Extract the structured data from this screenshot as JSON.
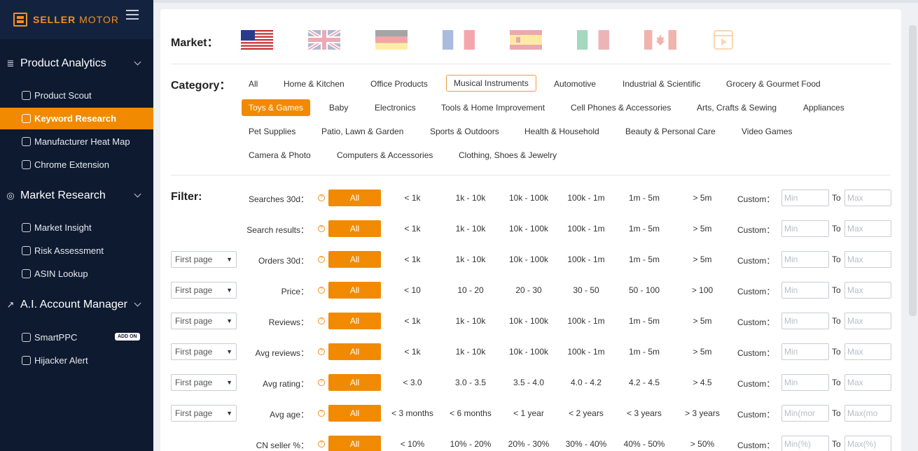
{
  "brand": {
    "bold": "SELLER",
    "light": "MOTOR"
  },
  "sidebar": {
    "groups": [
      {
        "label": "Product Analytics",
        "icon": "search-list-icon",
        "items": [
          {
            "label": "Product Scout",
            "icon": "scout-icon"
          },
          {
            "label": "Keyword Research",
            "icon": "keyword-icon",
            "active": true
          },
          {
            "label": "Manufacturer Heat Map",
            "icon": "map-pin-icon"
          },
          {
            "label": "Chrome Extension",
            "icon": "chrome-icon"
          }
        ]
      },
      {
        "label": "Market Research",
        "icon": "compass-icon",
        "items": [
          {
            "label": "Market Insight",
            "icon": "bar-chart-icon"
          },
          {
            "label": "Risk Assessment",
            "icon": "edit-icon"
          },
          {
            "label": "ASIN Lookup",
            "icon": "cubes-icon"
          }
        ]
      },
      {
        "label": "A.I. Account Manager",
        "icon": "trend-icon",
        "items": [
          {
            "label": "SmartPPC",
            "icon": "cloud-icon",
            "badge": "ADD ON"
          },
          {
            "label": "Hijacker Alert",
            "icon": "alert-icon"
          }
        ]
      }
    ]
  },
  "market": {
    "label": "Market：",
    "flags": [
      "US",
      "UK",
      "DE",
      "FR",
      "ES",
      "IT",
      "CA",
      "Video"
    ]
  },
  "category": {
    "label": "Category：",
    "rows": [
      [
        "All",
        "Home & Kitchen",
        "Office Products",
        "Musical Instruments",
        "Automotive",
        "Industrial & Scientific",
        "Grocery & Gourmet Food"
      ],
      [
        "Toys & Games",
        "Baby",
        "Electronics",
        "Tools & Home Improvement",
        "Cell Phones & Accessories",
        "Arts, Crafts & Sewing",
        "Appliances"
      ],
      [
        "Pet Supplies",
        "Patio, Lawn & Garden",
        "Sports & Outdoors",
        "Health & Household",
        "Beauty & Personal Care",
        "Video Games"
      ],
      [
        "Camera & Photo",
        "Computers & Accessories",
        "Clothing, Shoes & Jewelry"
      ]
    ],
    "selected": "Toys & Games",
    "highlighted": "Musical Instruments"
  },
  "filter": {
    "label": "Filter:",
    "all_label": "All",
    "custom_label": "Custom：",
    "to_label": "To",
    "select_value": "First page",
    "rows": [
      {
        "label": "Searches 30d：",
        "select": false,
        "options": [
          "< 1k",
          "1k - 10k",
          "10k - 100k",
          "100k - 1m",
          "1m - 5m",
          "> 5m"
        ],
        "min": "Min",
        "max": "Max"
      },
      {
        "label": "Search results：",
        "select": false,
        "options": [
          "< 1k",
          "1k - 10k",
          "10k - 100k",
          "100k - 1m",
          "1m - 5m",
          "> 5m"
        ],
        "min": "Min",
        "max": "Max"
      },
      {
        "label": "Orders 30d：",
        "select": true,
        "options": [
          "< 1k",
          "1k - 10k",
          "10k - 100k",
          "100k - 1m",
          "1m - 5m",
          "> 5m"
        ],
        "min": "Min",
        "max": "Max"
      },
      {
        "label": "Price：",
        "select": true,
        "options": [
          "< 10",
          "10 - 20",
          "20 - 30",
          "30 - 50",
          "50 - 100",
          "> 100"
        ],
        "min": "Min",
        "max": "Max"
      },
      {
        "label": "Reviews：",
        "select": true,
        "options": [
          "< 1k",
          "1k - 10k",
          "10k - 100k",
          "100k - 1m",
          "1m - 5m",
          "> 5m"
        ],
        "min": "Min",
        "max": "Max"
      },
      {
        "label": "Avg reviews：",
        "select": true,
        "options": [
          "< 1k",
          "1k - 10k",
          "10k - 100k",
          "100k - 1m",
          "1m - 5m",
          "> 5m"
        ],
        "min": "Min",
        "max": "Max"
      },
      {
        "label": "Avg rating：",
        "select": true,
        "options": [
          "< 3.0",
          "3.0 - 3.5",
          "3.5 - 4.0",
          "4.0 - 4.2",
          "4.2 - 4.5",
          "> 4.5"
        ],
        "min": "Min",
        "max": "Max"
      },
      {
        "label": "Avg age：",
        "select": true,
        "options": [
          "< 3 months",
          "< 6 months",
          "< 1 year",
          "< 2 years",
          "< 3 years",
          "> 3 years"
        ],
        "min": "Min(mor",
        "max": "Max(mo"
      },
      {
        "label": "CN seller %：",
        "select": false,
        "options": [
          "< 10%",
          "10% - 20%",
          "20% - 30%",
          "30% - 40%",
          "40% - 50%",
          "> 50%"
        ],
        "min": "Min(%)",
        "max": "Max(%)"
      }
    ]
  }
}
